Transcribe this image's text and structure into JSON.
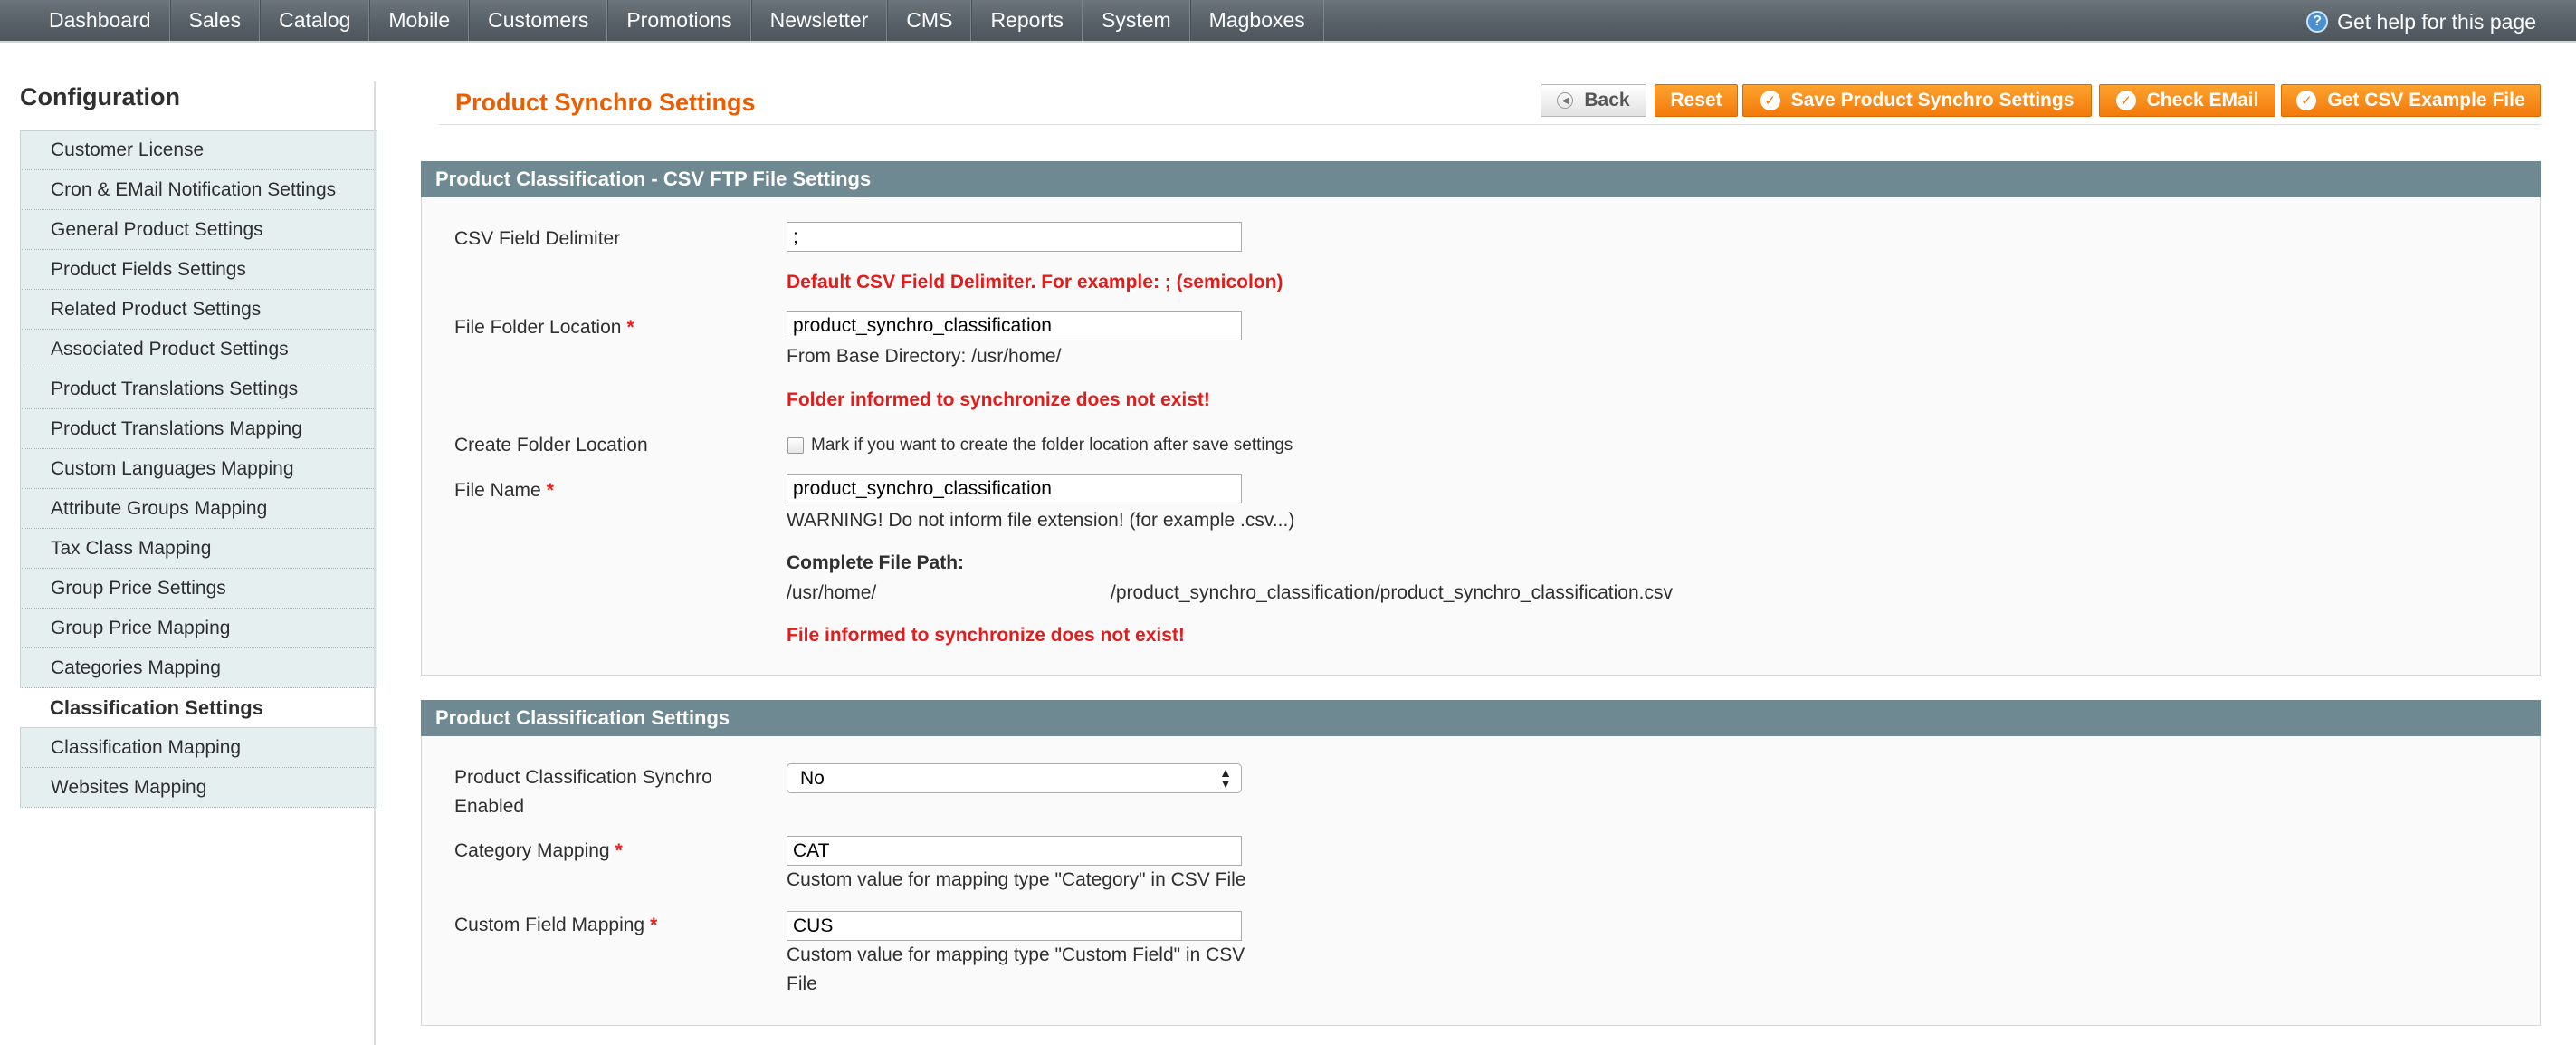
{
  "topnav": {
    "items": [
      "Dashboard",
      "Sales",
      "Catalog",
      "Mobile",
      "Customers",
      "Promotions",
      "Newsletter",
      "CMS",
      "Reports",
      "System",
      "Magboxes"
    ],
    "help": "Get help for this page"
  },
  "sidebar": {
    "title": "Configuration",
    "items": [
      "Customer License",
      "Cron & EMail Notification Settings",
      "General Product Settings",
      "Product Fields Settings",
      "Related Product Settings",
      "Associated Product Settings",
      "Product Translations Settings",
      "Product Translations Mapping",
      "Custom Languages Mapping",
      "Attribute Groups Mapping",
      "Tax Class Mapping",
      "Group Price Settings",
      "Group Price Mapping",
      "Categories Mapping",
      "Classification Settings",
      "Classification Mapping",
      "Websites Mapping"
    ]
  },
  "page": {
    "title": "Product Synchro Settings",
    "buttons": {
      "back": "Back",
      "reset": "Reset",
      "save": "Save Product Synchro Settings",
      "check": "Check EMail",
      "csv": "Get CSV Example File"
    }
  },
  "section1": {
    "title": "Product Classification - CSV FTP File Settings",
    "delimiter_label": "CSV Field Delimiter",
    "delimiter_value": ";",
    "delimiter_note": "Default CSV Field Delimiter. For example: ; (semicolon)",
    "folder_label": "File Folder Location",
    "folder_value": "product_synchro_classification",
    "folder_note": "From Base Directory: /usr/home/",
    "folder_warn": "Folder informed to synchronize does not exist!",
    "create_label": "Create Folder Location",
    "create_note": "Mark if you want to create the folder location after save settings",
    "filename_label": "File Name",
    "filename_value": "product_synchro_classification",
    "filename_note": "WARNING! Do not inform file extension! (for example .csv...)",
    "path_label": "Complete File Path:",
    "path_base": "/usr/home/",
    "path_rest": "/product_synchro_classification/product_synchro_classification.csv",
    "file_warn": "File informed to synchronize does not exist!"
  },
  "section2": {
    "title": "Product Classification Settings",
    "enabled_label_line1": "Product Classification Synchro",
    "enabled_label_line2": "Enabled",
    "enabled_value": "No",
    "category_label": "Category Mapping",
    "category_value": "CAT",
    "category_note": "Custom value for mapping type \"Category\" in CSV File",
    "custom_label": "Custom Field Mapping",
    "custom_value": "CUS",
    "custom_note_line1": "Custom value for mapping type \"Custom Field\" in CSV",
    "custom_note_line2": "File"
  },
  "required_mark": "*"
}
